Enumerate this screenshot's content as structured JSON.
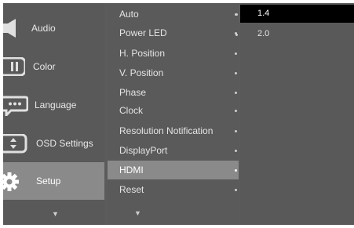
{
  "sidebar": {
    "items": [
      {
        "label": "Audio",
        "icon": "speaker-icon"
      },
      {
        "label": "Color",
        "icon": "color-icon"
      },
      {
        "label": "Language",
        "icon": "language-icon"
      },
      {
        "label": "OSD Settings",
        "icon": "osd-settings-icon"
      },
      {
        "label": "Setup",
        "icon": "gear-icon",
        "active": true
      }
    ],
    "more_arrow": "▼"
  },
  "menu": {
    "items": [
      {
        "label": "Auto"
      },
      {
        "label": "Power LED"
      },
      {
        "label": "H. Position"
      },
      {
        "label": "V. Position"
      },
      {
        "label": "Phase"
      },
      {
        "label": "Clock"
      },
      {
        "label": "Resolution Notification"
      },
      {
        "label": "DisplayPort"
      },
      {
        "label": "HDMI",
        "active": true
      },
      {
        "label": "Reset"
      }
    ],
    "more_arrow": "▼"
  },
  "options": {
    "items": [
      {
        "label": "1.4",
        "selected": true
      },
      {
        "label": "2.0"
      }
    ]
  },
  "colors": {
    "panel": "#5a5a5a",
    "active": "#8a8a8a",
    "selected": "#000000",
    "text": "#e4e4e4"
  }
}
